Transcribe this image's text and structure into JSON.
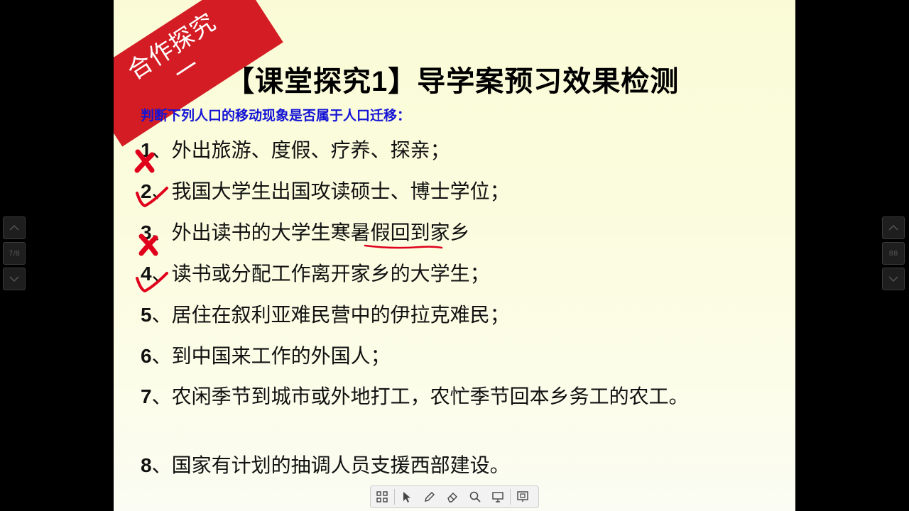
{
  "ribbon": {
    "line1": "合作探究",
    "line2": "一"
  },
  "title": "【课堂探究1】导学案预习效果检测",
  "subtitle": "判断下列人口的移动现象是否属于人口迁移：",
  "items": [
    {
      "num": "1",
      "text": "、外出旅游、度假、疗养、探亲；",
      "mark": "cross"
    },
    {
      "num": "2",
      "text": "、我国大学生出国攻读硕士、博士学位；",
      "mark": "check"
    },
    {
      "num": "3",
      "text": "、外出读书的大学生寒暑假回到家乡",
      "mark": "cross"
    },
    {
      "num": "4",
      "text": "、读书或分配工作离开家乡的大学生；",
      "mark": "check"
    },
    {
      "num": "5",
      "text": "、居住在叙利亚难民营中的伊拉克难民；",
      "mark": ""
    },
    {
      "num": "6",
      "text": "、到中国来工作的外国人；",
      "mark": ""
    },
    {
      "num": "7",
      "text": "、农闲季节到城市或外地打工，农忙季节回本乡务工的农工。",
      "mark": ""
    },
    {
      "num": "8",
      "text": "、国家有计划的抽调人员支援西部建设。",
      "mark": ""
    }
  ],
  "side_left": {
    "page": "7/8"
  },
  "side_right": {
    "page": "88"
  },
  "toolbar": {
    "buttons": [
      "grid-icon",
      "pointer-icon",
      "pen-icon",
      "eraser-icon",
      "search-icon",
      "screen-icon",
      "presenter-icon"
    ]
  },
  "colors": {
    "ribbon": "#d31c23",
    "subtitle": "#1414d6",
    "marks": "#e0001b"
  }
}
